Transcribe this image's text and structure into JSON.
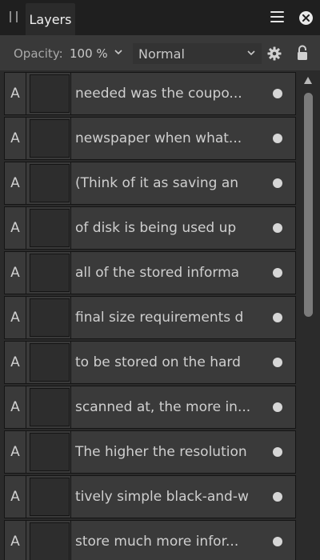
{
  "panel": {
    "tab_label": "Layers",
    "icons": {
      "grip": "grip-icon",
      "menu": "hamburger-menu-icon",
      "close": "close-icon"
    }
  },
  "options": {
    "opacity_label": "Opacity:",
    "opacity_value": "100 %",
    "blend_mode": "Normal",
    "icons": {
      "settings": "gear-icon",
      "lock": "lock-icon"
    }
  },
  "layers": [
    {
      "type": "A",
      "name": "needed was the coupo..."
    },
    {
      "type": "A",
      "name": "newspaper when what..."
    },
    {
      "type": "A",
      "name": "(Think of it as saving an"
    },
    {
      "type": "A",
      "name": "of disk is being used up"
    },
    {
      "type": "A",
      "name": "all of the stored informa"
    },
    {
      "type": "A",
      "name": "final size requirements d"
    },
    {
      "type": "A",
      "name": "to be stored on the hard"
    },
    {
      "type": "A",
      "name": "scanned at, the more in..."
    },
    {
      "type": "A",
      "name": "The higher the resolution"
    },
    {
      "type": "A",
      "name": "tively simple black-and-w"
    },
    {
      "type": "A",
      "name": "store much more infor..."
    }
  ],
  "colors": {
    "panel_bg": "#2b2b2b",
    "tabbar_bg": "#1f1f1f",
    "row_bg": "#3a3a3a",
    "text": "#cfcfcf"
  }
}
